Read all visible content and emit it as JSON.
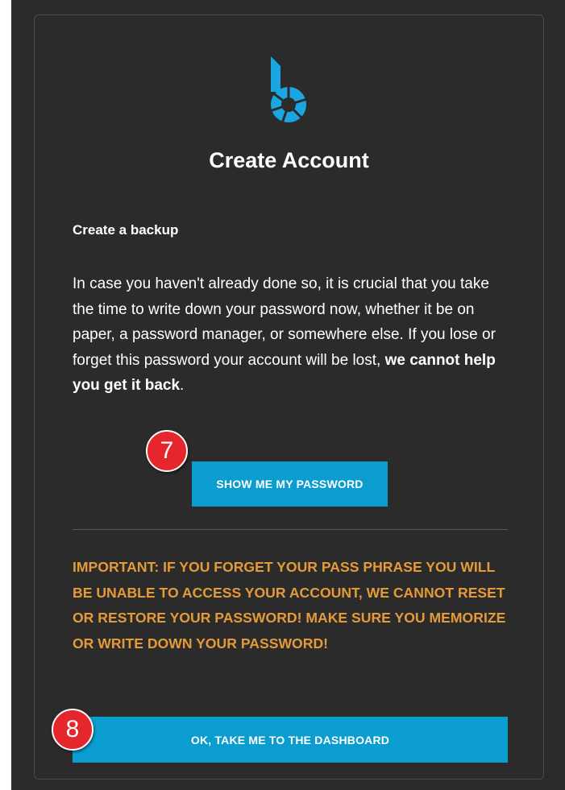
{
  "header": {
    "title": "Create Account"
  },
  "section": {
    "subtitle": "Create a backup",
    "body_prefix": "In case you haven't already done so, it is crucial that you take the time to write down your password now, whether it be on paper, a password manager, or somewhere else. If you lose or forget this password your account will be lost, ",
    "body_bold": "we cannot help you get it back",
    "body_suffix": "."
  },
  "buttons": {
    "show_password": "SHOW ME MY PASSWORD",
    "dashboard": "OK, TAKE ME TO THE DASHBOARD"
  },
  "warning": {
    "text": "IMPORTANT: IF YOU FORGET YOUR PASS PHRASE YOU WILL BE UNABLE TO ACCESS YOUR ACCOUNT, WE CANNOT RESET OR RESTORE YOUR PASSWORD! MAKE SURE YOU MEMORIZE OR WRITE DOWN YOUR PASSWORD!"
  },
  "annotations": {
    "step_a": "7",
    "step_b": "8"
  },
  "colors": {
    "accent": "#0b9dd0",
    "warning": "#e49a39",
    "badge": "#e6262d",
    "background": "#2b2b2b"
  },
  "icons": {
    "logo": "bitshares-logo-icon"
  }
}
